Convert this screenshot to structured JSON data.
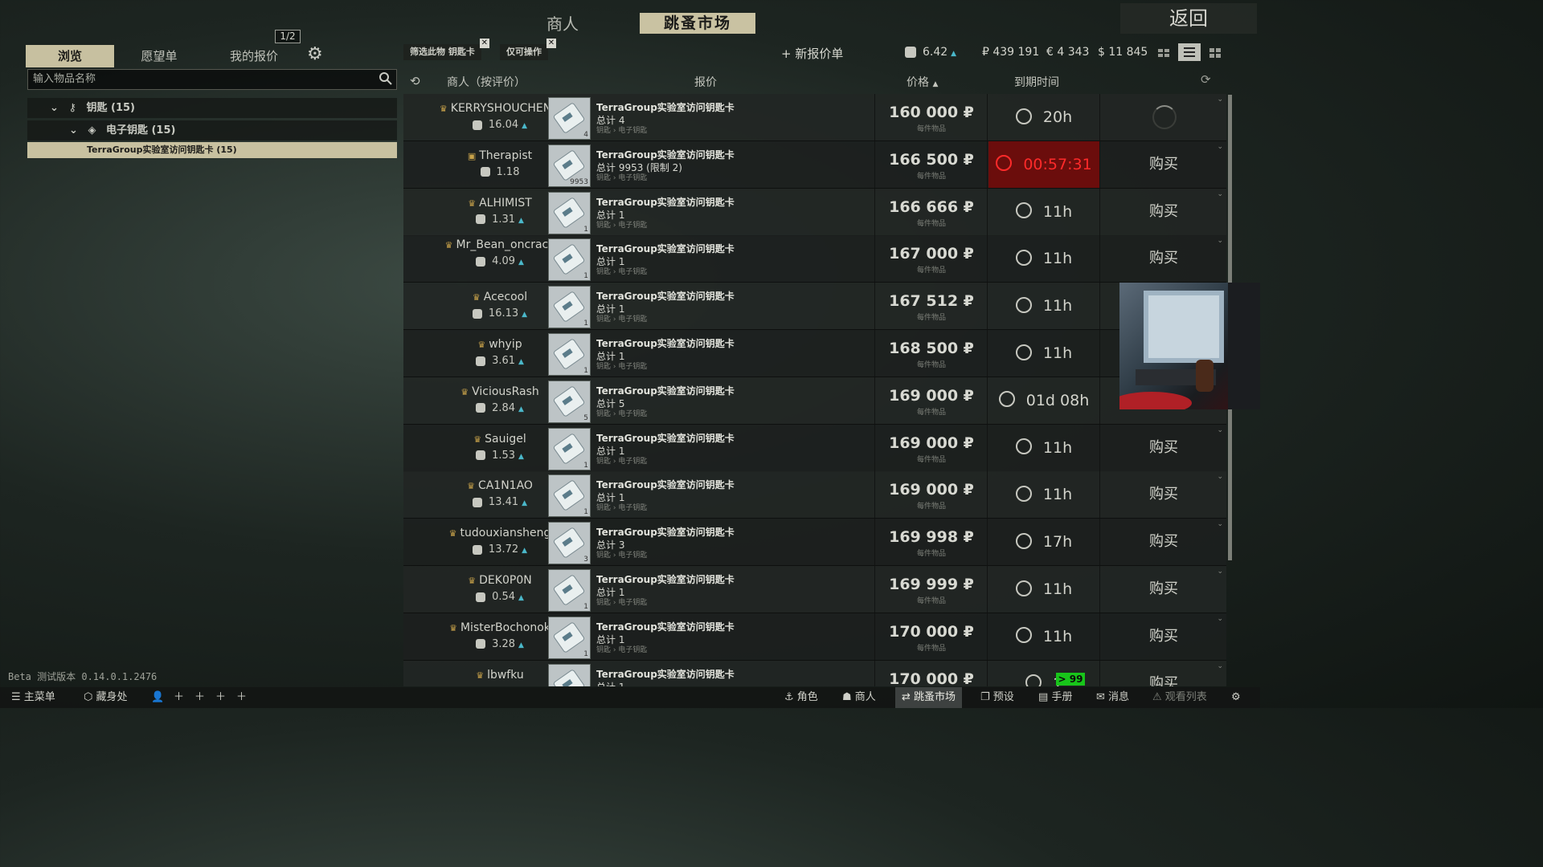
{
  "top_nav": {
    "trader": "商人",
    "flea_market": "跳蚤市场",
    "back": "返回"
  },
  "left_panel": {
    "tabs": [
      "浏览",
      "愿望单",
      "我的报价"
    ],
    "page_indicator": "1/2",
    "search_placeholder": "输入物品名称",
    "tree": [
      "钥匙 (15)",
      "电子钥匙 (15)",
      "TerraGroup实验室访问钥匙卡 (15)"
    ]
  },
  "filters": {
    "chip1": "筛选此物 钥匙卡",
    "chip2": "仅可操作",
    "new_offer": "+ 新报价单"
  },
  "currency": {
    "rating": "6.42",
    "rub": "₽ 439 191",
    "eur": "€ 4 343",
    "usd": "$ 11 845"
  },
  "table_header": {
    "seller": "商人（按评价）",
    "offer": "报价",
    "price": "价格",
    "expiry": "到期时间"
  },
  "rows": [
    {
      "seller": "KERRYSHOUCHENG",
      "rating": "16.04",
      "item": "TerraGroup实验室访问钥匙卡",
      "total": "总计 4",
      "count": "4",
      "category": "钥匙 › 电子钥匙",
      "price": "160 000 ₽",
      "per_unit": "每件物品",
      "time": "20h",
      "buy": ""
    },
    {
      "seller": "Therapist",
      "rating": "1.18",
      "item": "TerraGroup实验室访问钥匙卡",
      "total": "总计 9953 (限制 2)",
      "count": "9953",
      "category": "钥匙 › 电子钥匙",
      "price": "166 500 ₽",
      "per_unit": "每件物品",
      "time": "00:57:31",
      "buy": "购买"
    },
    {
      "seller": "ALHIMIST",
      "rating": "1.31",
      "item": "TerraGroup实验室访问钥匙卡",
      "total": "总计 1",
      "count": "1",
      "category": "钥匙 › 电子钥匙",
      "price": "166 666 ₽",
      "per_unit": "每件物品",
      "time": "11h",
      "buy": "购买"
    },
    {
      "seller": "Mr_Bean_oncrack",
      "rating": "4.09",
      "item": "TerraGroup实验室访问钥匙卡",
      "total": "总计 1",
      "count": "1",
      "category": "钥匙 › 电子钥匙",
      "price": "167 000 ₽",
      "per_unit": "每件物品",
      "time": "11h",
      "buy": "购买"
    },
    {
      "seller": "Acecool",
      "rating": "16.13",
      "item": "TerraGroup实验室访问钥匙卡",
      "total": "总计 1",
      "count": "1",
      "category": "钥匙 › 电子钥匙",
      "price": "167 512 ₽",
      "per_unit": "每件物品",
      "time": "11h",
      "buy": ""
    },
    {
      "seller": "whyip",
      "rating": "3.61",
      "item": "TerraGroup实验室访问钥匙卡",
      "total": "总计 1",
      "count": "1",
      "category": "钥匙 › 电子钥匙",
      "price": "168 500 ₽",
      "per_unit": "每件物品",
      "time": "11h",
      "buy": ""
    },
    {
      "seller": "ViciousRash",
      "rating": "2.84",
      "item": "TerraGroup实验室访问钥匙卡",
      "total": "总计 5",
      "count": "5",
      "category": "钥匙 › 电子钥匙",
      "price": "169 000 ₽",
      "per_unit": "每件物品",
      "time": "01d 08h",
      "buy": ""
    },
    {
      "seller": "Sauigel",
      "rating": "1.53",
      "item": "TerraGroup实验室访问钥匙卡",
      "total": "总计 1",
      "count": "1",
      "category": "钥匙 › 电子钥匙",
      "price": "169 000 ₽",
      "per_unit": "每件物品",
      "time": "11h",
      "buy": "购买"
    },
    {
      "seller": "CA1N1AO",
      "rating": "13.41",
      "item": "TerraGroup实验室访问钥匙卡",
      "total": "总计 1",
      "count": "1",
      "category": "钥匙 › 电子钥匙",
      "price": "169 000 ₽",
      "per_unit": "每件物品",
      "time": "11h",
      "buy": "购买"
    },
    {
      "seller": "tudouxiansheng",
      "rating": "13.72",
      "item": "TerraGroup实验室访问钥匙卡",
      "total": "总计 3",
      "count": "3",
      "category": "钥匙 › 电子钥匙",
      "price": "169 998 ₽",
      "per_unit": "每件物品",
      "time": "17h",
      "buy": "购买"
    },
    {
      "seller": "DEK0P0N",
      "rating": "0.54",
      "item": "TerraGroup实验室访问钥匙卡",
      "total": "总计 1",
      "count": "1",
      "category": "钥匙 › 电子钥匙",
      "price": "169 999 ₽",
      "per_unit": "每件物品",
      "time": "11h",
      "buy": "购买"
    },
    {
      "seller": "MisterBochonok",
      "rating": "3.28",
      "item": "TerraGroup实验室访问钥匙卡",
      "total": "总计 1",
      "count": "1",
      "category": "钥匙 › 电子钥匙",
      "price": "170 000 ₽",
      "per_unit": "每件物品",
      "time": "11h",
      "buy": "购买"
    },
    {
      "seller": "lbwfku",
      "rating": "",
      "item": "TerraGroup实验室访问钥匙卡",
      "total": "总计 1",
      "count": "1",
      "category": "钥匙 › 电子钥匙",
      "price": "170 000 ₽",
      "per_unit": "每件物品",
      "time": "1",
      "buy": "购买"
    }
  ],
  "version": "Beta 测试版本 0.14.0.1.2476",
  "bottom_bar": {
    "main_menu": "主菜单",
    "hideout": "藏身处",
    "character": "角色",
    "traders": "商人",
    "flea": "跳蚤市场",
    "presets": "预设",
    "handbook": "手册",
    "messages": "消息",
    "watchlist": "观看列表",
    "badge": "> 99"
  }
}
